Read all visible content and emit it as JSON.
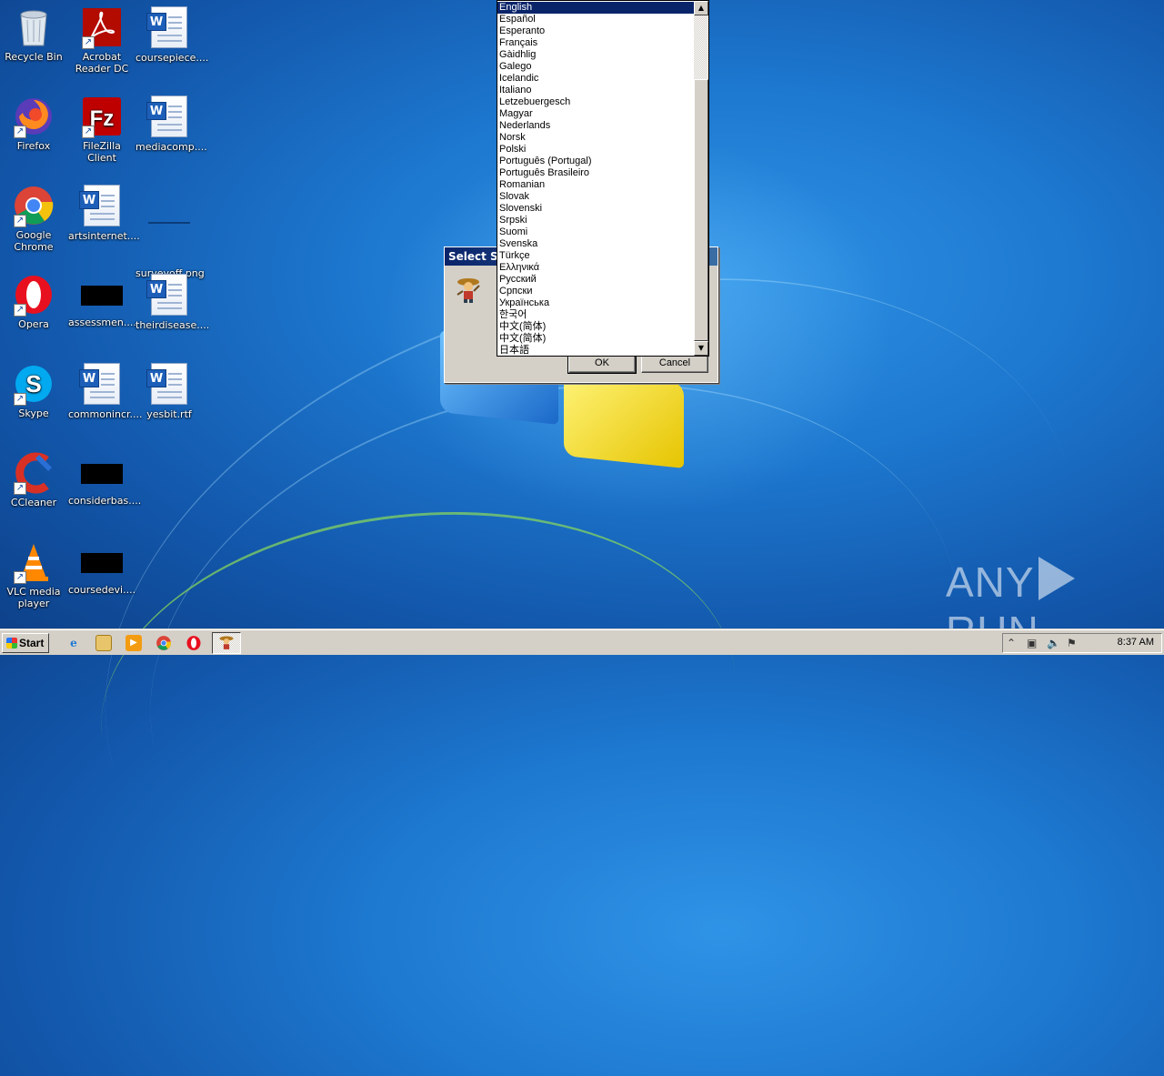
{
  "desktop": {
    "icons": [
      {
        "label": "Recycle Bin",
        "icon": "recycle-bin-icon"
      },
      {
        "label": "Acrobat Reader DC",
        "icon": "acrobat-icon"
      },
      {
        "label": "coursepiece....",
        "icon": "word-doc-icon"
      },
      {
        "label": "Firefox",
        "icon": "firefox-icon"
      },
      {
        "label": "FileZilla Client",
        "icon": "filezilla-icon"
      },
      {
        "label": "mediacomp....",
        "icon": "word-doc-icon"
      },
      {
        "label": "Google Chrome",
        "icon": "chrome-icon"
      },
      {
        "label": "artsinternet....",
        "icon": "word-doc-icon"
      },
      {
        "label": "surveyoff.png",
        "icon": "image-file-icon"
      },
      {
        "label": "Opera",
        "icon": "opera-icon"
      },
      {
        "label": "assessmen....",
        "icon": "black-file-icon"
      },
      {
        "label": "theirdisease....",
        "icon": "word-doc-icon"
      },
      {
        "label": "Skype",
        "icon": "skype-icon"
      },
      {
        "label": "commonincr....",
        "icon": "word-doc-icon"
      },
      {
        "label": "yesbit.rtf",
        "icon": "word-doc-icon"
      },
      {
        "label": "CCleaner",
        "icon": "ccleaner-icon"
      },
      {
        "label": "considerbas....",
        "icon": "black-file-icon"
      },
      {
        "label": "VLC media player",
        "icon": "vlc-icon"
      },
      {
        "label": "coursedevi....",
        "icon": "black-file-icon"
      }
    ]
  },
  "dialog": {
    "title": "Select Setup Language",
    "ok_label": "OK",
    "cancel_label": "Cancel"
  },
  "language_list": {
    "selected": "English",
    "items": [
      "English",
      "Español",
      "Esperanto",
      "Français",
      "Gàidhlig",
      "Galego",
      "Icelandic",
      "Italiano",
      "Letzebuergesch",
      "Magyar",
      "Nederlands",
      "Norsk",
      "Polski",
      "Português (Portugal)",
      "Português Brasileiro",
      "Romanian",
      "Slovak",
      "Slovenski",
      "Srpski",
      "Suomi",
      "Svenska",
      "Türkçe",
      "Ελληνικά",
      "Русский",
      "Српски",
      "Українська",
      "한국어",
      "中文(简体)",
      "中文(简体)",
      "日本語"
    ]
  },
  "taskbar": {
    "start_label": "Start",
    "clock": "8:37 AM",
    "pinned": [
      "ie-icon",
      "explorer-icon",
      "media-player-icon",
      "chrome-icon",
      "opera-icon"
    ]
  },
  "watermark": {
    "left": "ANY",
    "right": "RUN"
  },
  "colors": {
    "selection": "#0a246a",
    "titlebar": "#0a246a",
    "dialog_face": "#d4d0c8"
  }
}
